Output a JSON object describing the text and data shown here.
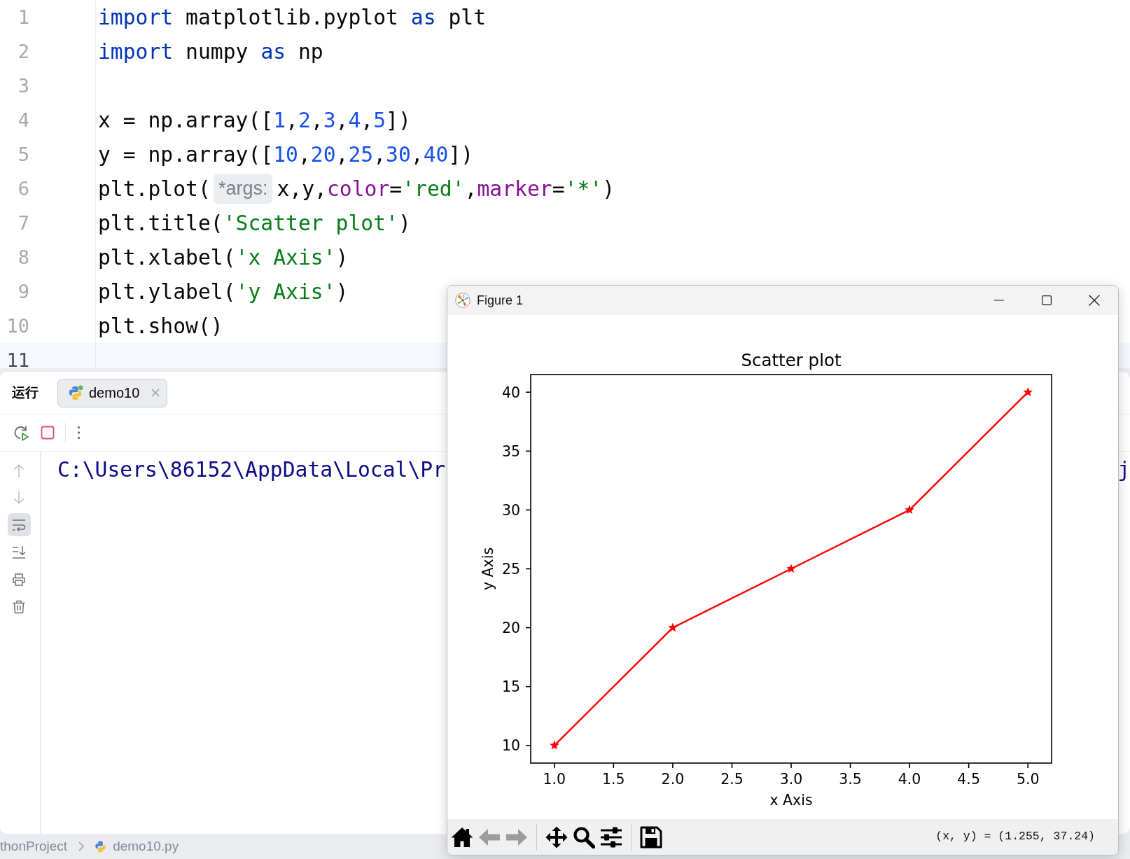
{
  "editor": {
    "lines": [
      {
        "number": "1",
        "current": false,
        "tokens": [
          {
            "kind": "keyword",
            "text": "import"
          },
          {
            "kind": "plain",
            "text": " matplotlib.pyplot "
          },
          {
            "kind": "keyword",
            "text": "as"
          },
          {
            "kind": "plain",
            "text": " plt"
          }
        ]
      },
      {
        "number": "2",
        "current": false,
        "tokens": [
          {
            "kind": "keyword",
            "text": "import"
          },
          {
            "kind": "plain",
            "text": " numpy "
          },
          {
            "kind": "keyword",
            "text": "as"
          },
          {
            "kind": "plain",
            "text": " np"
          }
        ]
      },
      {
        "number": "3",
        "current": false
      },
      {
        "number": "4",
        "current": false,
        "tokens": [
          {
            "kind": "plain",
            "text": "x = np.array(["
          },
          {
            "kind": "number",
            "text": "1"
          },
          {
            "kind": "plain",
            "text": ","
          },
          {
            "kind": "number",
            "text": "2"
          },
          {
            "kind": "plain",
            "text": ","
          },
          {
            "kind": "number",
            "text": "3"
          },
          {
            "kind": "plain",
            "text": ","
          },
          {
            "kind": "number",
            "text": "4"
          },
          {
            "kind": "plain",
            "text": ","
          },
          {
            "kind": "number",
            "text": "5"
          },
          {
            "kind": "plain",
            "text": "])"
          }
        ]
      },
      {
        "number": "5",
        "current": false,
        "tokens": [
          {
            "kind": "plain",
            "text": "y = np.array(["
          },
          {
            "kind": "number",
            "text": "10"
          },
          {
            "kind": "plain",
            "text": ","
          },
          {
            "kind": "number",
            "text": "20"
          },
          {
            "kind": "plain",
            "text": ","
          },
          {
            "kind": "number",
            "text": "25"
          },
          {
            "kind": "plain",
            "text": ","
          },
          {
            "kind": "number",
            "text": "30"
          },
          {
            "kind": "plain",
            "text": ","
          },
          {
            "kind": "number",
            "text": "40"
          },
          {
            "kind": "plain",
            "text": "])"
          }
        ]
      },
      {
        "number": "6",
        "current": false,
        "tokens": [
          {
            "kind": "plain",
            "text": "plt.plot("
          },
          {
            "kind": "hint",
            "text": "*args:"
          },
          {
            "kind": "plain",
            "text": "x,y,"
          },
          {
            "kind": "param",
            "text": "color"
          },
          {
            "kind": "plain",
            "text": "="
          },
          {
            "kind": "string",
            "text": "'red'"
          },
          {
            "kind": "plain",
            "text": ","
          },
          {
            "kind": "param",
            "text": "marker"
          },
          {
            "kind": "plain",
            "text": "="
          },
          {
            "kind": "string",
            "text": "'*'"
          },
          {
            "kind": "plain",
            "text": ")"
          }
        ]
      },
      {
        "number": "7",
        "current": false,
        "tokens": [
          {
            "kind": "plain",
            "text": "plt.title("
          },
          {
            "kind": "string",
            "text": "'Scatter plot'"
          },
          {
            "kind": "plain",
            "text": ")"
          }
        ]
      },
      {
        "number": "8",
        "current": false,
        "tokens": [
          {
            "kind": "plain",
            "text": "plt.xlabel("
          },
          {
            "kind": "string",
            "text": "'x Axis'"
          },
          {
            "kind": "plain",
            "text": ")"
          }
        ]
      },
      {
        "number": "9",
        "current": false,
        "tokens": [
          {
            "kind": "plain",
            "text": "plt.ylabel("
          },
          {
            "kind": "string",
            "text": "'y Axis'"
          },
          {
            "kind": "plain",
            "text": ")"
          }
        ]
      },
      {
        "number": "10",
        "current": false,
        "tokens": [
          {
            "kind": "plain",
            "text": "plt.show()"
          }
        ]
      },
      {
        "number": "11",
        "current": true
      }
    ]
  },
  "run_panel": {
    "title": "运行",
    "tabs": [
      {
        "label": "demo10",
        "selected": true
      }
    ],
    "side_tools": [
      {
        "kind": "up",
        "disabled": true,
        "on": false
      },
      {
        "kind": "down",
        "disabled": true,
        "on": false
      },
      {
        "kind": "wrap",
        "disabled": false,
        "on": true
      },
      {
        "kind": "scroll_end",
        "disabled": false,
        "on": false
      },
      {
        "kind": "print",
        "disabled": false,
        "on": false
      },
      {
        "kind": "clear",
        "disabled": false,
        "on": false
      }
    ],
    "console": {
      "line": "C:\\Users\\86152\\AppData\\Local\\Pr",
      "line_tail": "j"
    }
  },
  "status_bar": {
    "breadcrumbs": [
      {
        "label": "thonProject",
        "kind": "folder"
      },
      {
        "label": "demo10.py",
        "kind": "python_file"
      }
    ]
  },
  "figure": {
    "title": "Figure 1",
    "chart_data": [
      {
        "type": "line",
        "title": "Scatter plot",
        "xlabel": "x Axis",
        "ylabel": "y Axis",
        "x": [
          1,
          2,
          3,
          4,
          5
        ],
        "values": [
          10,
          20,
          25,
          30,
          40
        ],
        "color": "#ff0000",
        "marker": "*",
        "xlim": [
          0.8,
          5.2
        ],
        "ylim": [
          8.5,
          41.5
        ],
        "xticks": [
          {
            "value": 1,
            "label": "1.0"
          },
          {
            "value": 1.5,
            "label": "1.5"
          },
          {
            "value": 2,
            "label": "2.0"
          },
          {
            "value": 2.5,
            "label": "2.5"
          },
          {
            "value": 3,
            "label": "3.0"
          },
          {
            "value": 3.5,
            "label": "3.5"
          },
          {
            "value": 4,
            "label": "4.0"
          },
          {
            "value": 4.5,
            "label": "4.5"
          },
          {
            "value": 5,
            "label": "5.0"
          }
        ],
        "yticks": [
          10,
          15,
          20,
          25,
          30,
          35,
          40
        ]
      }
    ],
    "toolbar_groups": [
      {
        "buttons": [
          {
            "kind": "home",
            "disabled": false
          },
          {
            "kind": "back",
            "disabled": true
          },
          {
            "kind": "forward",
            "disabled": true
          }
        ]
      },
      {
        "buttons": [
          {
            "kind": "pan",
            "disabled": false
          },
          {
            "kind": "zoom",
            "disabled": false
          },
          {
            "kind": "configure",
            "disabled": false
          }
        ]
      },
      {
        "buttons": [
          {
            "kind": "save",
            "disabled": false
          }
        ]
      }
    ],
    "status": "(x, y) = (1.255, 37.24)"
  }
}
